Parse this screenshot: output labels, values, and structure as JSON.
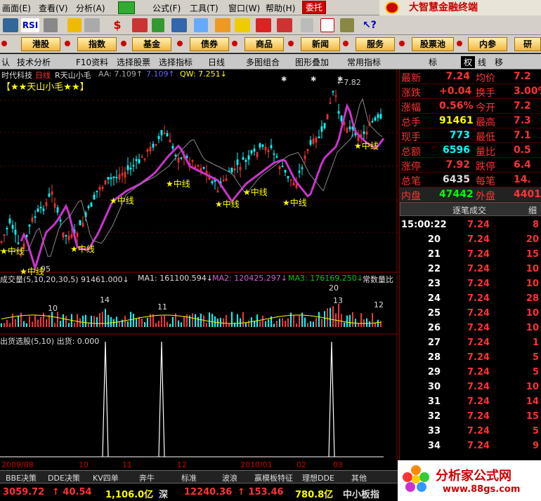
{
  "menu": {
    "items": [
      "画面(E)",
      "查看(V)",
      "分析(A)",
      "公式(F)",
      "工具(T)",
      "窗口(W)",
      "帮助(H)"
    ],
    "weituo": "委托",
    "brand": "大智慧金融终端"
  },
  "toolbar": {
    "rsi": "RSI"
  },
  "nav": {
    "items": [
      "港股",
      "指数",
      "基金",
      "债券",
      "商品",
      "新闻",
      "服务",
      "股票池",
      "内参",
      "研"
    ]
  },
  "tabs": {
    "items": [
      "认",
      "技术分析",
      "F10资料",
      "选择股票",
      "选择指标",
      "日线",
      "多图组合",
      "图形叠加",
      "常用指标"
    ],
    "right": [
      "标",
      "权",
      "线",
      "移"
    ]
  },
  "chart": {
    "stock_title": "时代科技",
    "period": "日线",
    "indicator": "R天山小毛",
    "aa_label": "AA: 7.109↑",
    "val2": "7.109↑",
    "qw": "QW: 7.251↓",
    "banner": "【★★天山小毛★★】",
    "peak": "←7.82",
    "low_label": "95",
    "signal_label": "中线",
    "vol_line": "成交量(5,10,20,30,5) 91461.000↓",
    "ma1": "MA1: 161100.594↓",
    "ma2": "MA2: 120425.297↓",
    "ma3": "MA3: 176169.250↓",
    "vol_ratio": "常数量比",
    "vol_marks": [
      "10",
      "14",
      "11",
      "20",
      "13",
      "12"
    ],
    "sell_line": "出货选股(5,10) 出货: 0.000",
    "time_labels": [
      "2009/08",
      "10",
      "11",
      "12",
      "2010/01",
      "02",
      "03"
    ]
  },
  "quote": {
    "rows": [
      {
        "l": "最新",
        "v": "7.24",
        "r": "均价",
        "rv": "7.2",
        "c": "#f33"
      },
      {
        "l": "涨跌",
        "v": "+0.04",
        "r": "换手",
        "rv": "3.00%",
        "c": "#f33"
      },
      {
        "l": "涨幅",
        "v": "0.56%",
        "r": "今开",
        "rv": "7.2",
        "c": "#f33"
      },
      {
        "l": "总手",
        "v": "91461",
        "r": "最高",
        "rv": "7.3",
        "c": "#ff0"
      },
      {
        "l": "现手",
        "v": "773",
        "r": "最低",
        "rv": "7.1",
        "c": "#0ff"
      },
      {
        "l": "总额",
        "v": "6596",
        "r": "量比",
        "rv": "0.5",
        "c": "#0ff"
      },
      {
        "l": "涨停",
        "v": "7.92",
        "r": "跌停",
        "rv": "6.4",
        "c": "#f33"
      },
      {
        "l": "总笔",
        "v": "6435",
        "r": "每笔",
        "rv": "14.",
        "c": "#ddd"
      },
      {
        "l": "内盘",
        "v": "47442",
        "r": "外盘",
        "rv": "4401",
        "c": "#0f0"
      }
    ],
    "tick_header": "逐笔成交",
    "tick_tab": "细",
    "ticks": [
      {
        "t": "15:00:22",
        "p": "7.24",
        "v": "8"
      },
      {
        "t": "20",
        "p": "7.24",
        "v": "20"
      },
      {
        "t": "21",
        "p": "7.24",
        "v": "15"
      },
      {
        "t": "22",
        "p": "7.24",
        "v": "10"
      },
      {
        "t": "23",
        "p": "7.24",
        "v": "10"
      },
      {
        "t": "24",
        "p": "7.24",
        "v": "28"
      },
      {
        "t": "25",
        "p": "7.24",
        "v": "10"
      },
      {
        "t": "26",
        "p": "7.24",
        "v": "10"
      },
      {
        "t": "27",
        "p": "7.24",
        "v": "1"
      },
      {
        "t": "28",
        "p": "7.24",
        "v": "5"
      },
      {
        "t": "29",
        "p": "7.24",
        "v": "5"
      },
      {
        "t": "30",
        "p": "7.24",
        "v": "10"
      },
      {
        "t": "31",
        "p": "7.24",
        "v": "14"
      },
      {
        "t": "32",
        "p": "7.24",
        "v": "15"
      },
      {
        "t": "33",
        "p": "7.24",
        "v": "5"
      },
      {
        "t": "34",
        "p": "7.24",
        "v": "9"
      },
      {
        "t": "35",
        "p": "7.24",
        "v": "1"
      }
    ]
  },
  "bottom_tabs": [
    "BBE决策",
    "DDE决策",
    "KV四单",
    "奔牛",
    "标准",
    "波浪",
    "赢模板特征",
    "理想DDE",
    "其他"
  ],
  "status": [
    {
      "v": "3059.72",
      "c": "#f33"
    },
    {
      "v": "↑ 40.54",
      "c": "#f33"
    },
    {
      "v": "1,106.0亿",
      "c": "#ff0"
    },
    {
      "v": "深",
      "c": "#ddd"
    },
    {
      "v": "12240.36",
      "c": "#f33"
    },
    {
      "v": "↑ 153.46",
      "c": "#f33"
    },
    {
      "v": "780.8亿",
      "c": "#ff0"
    },
    {
      "v": "中小板指",
      "c": "#ddd"
    }
  ],
  "watermark": {
    "title": "分析家公式网",
    "url": "www.88gs.com"
  },
  "colors": {
    "up": "#ff3333",
    "down": "#00ffff",
    "ma": "#cc33cc",
    "signal": "#ffff00",
    "grid": "#800000"
  }
}
